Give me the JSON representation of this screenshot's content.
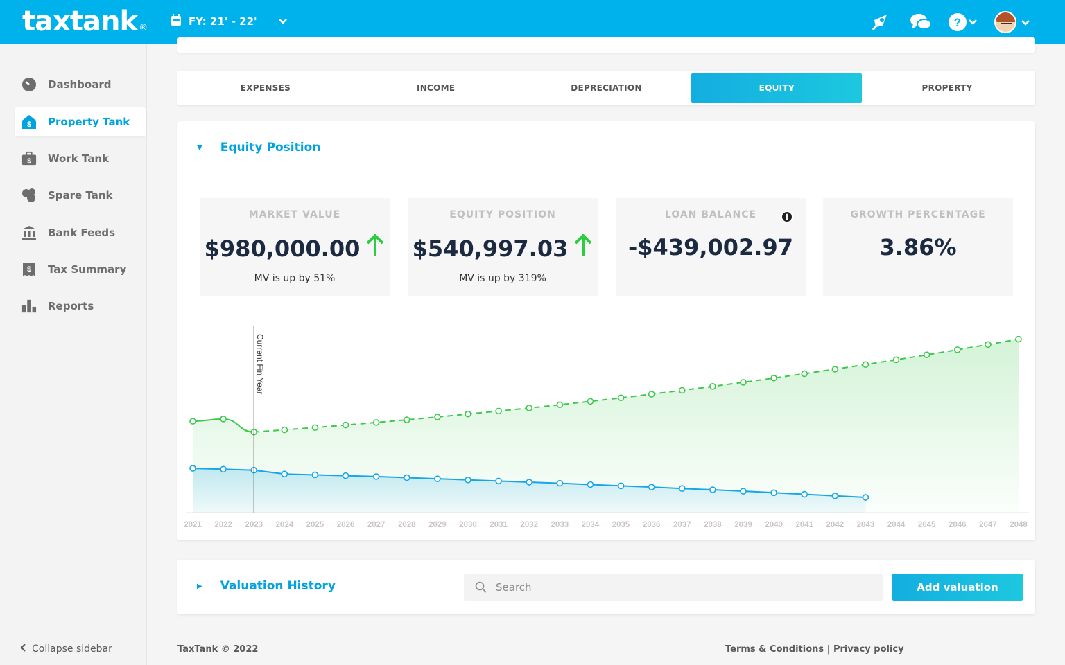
{
  "header": {
    "logo": "taxtank",
    "logo_mark": "®",
    "fy_label": "FY: 21' - 22'",
    "icons": [
      "rocket-icon",
      "chat-icon",
      "help-icon",
      "avatar"
    ]
  },
  "sidebar": {
    "items": [
      {
        "label": "Dashboard",
        "icon": "dashboard-icon",
        "active": false
      },
      {
        "label": "Property Tank",
        "icon": "property-icon",
        "active": true
      },
      {
        "label": "Work Tank",
        "icon": "briefcase-icon",
        "active": false
      },
      {
        "label": "Spare Tank",
        "icon": "coins-icon",
        "active": false
      },
      {
        "label": "Bank Feeds",
        "icon": "bank-icon",
        "active": false
      },
      {
        "label": "Tax Summary",
        "icon": "receipt-icon",
        "active": false
      },
      {
        "label": "Reports",
        "icon": "bar-chart-icon",
        "active": false
      }
    ],
    "collapse_label": "Collapse sidebar"
  },
  "tabs": [
    "EXPENSES",
    "INCOME",
    "DEPRECIATION",
    "EQUITY",
    "PROPERTY"
  ],
  "active_tab": "EQUITY",
  "equity": {
    "title": "Equity Position",
    "stats": [
      {
        "label": "MARKET VALUE",
        "value": "$980,000.00",
        "sub": "MV is up by 51%",
        "arrow": true
      },
      {
        "label": "EQUITY POSITION",
        "value": "$540,997.03",
        "sub": "MV is up by 319%",
        "arrow": true
      },
      {
        "label": "LOAN BALANCE",
        "value": "-$439,002.97",
        "sub": "",
        "info": true
      },
      {
        "label": "GROWTH PERCENTAGE",
        "value": "3.86%",
        "sub": ""
      }
    ],
    "current_year_label": "Current Fin Year"
  },
  "chart_data": {
    "type": "line",
    "x": [
      2021,
      2022,
      2023,
      2024,
      2025,
      2026,
      2027,
      2028,
      2029,
      2030,
      2031,
      2032,
      2033,
      2034,
      2035,
      2036,
      2037,
      2038,
      2039,
      2040,
      2041,
      2042,
      2043,
      2044,
      2045,
      2046,
      2047,
      2048
    ],
    "current_year": 2023,
    "series": [
      {
        "name": "",
        "color": "#3cc94b",
        "values": [
          648,
          664,
          571,
          587,
          603,
          621,
          639,
          658,
          678,
          699,
          720,
          742,
          765,
          789,
          814,
          840,
          867,
          895,
          924,
          954,
          985,
          1017,
          1050,
          1084,
          1119,
          1155,
          1192,
          1230
        ],
        "projected_from_index": 2
      },
      {
        "name": "",
        "color": "#14a6e6",
        "values": [
          314,
          308,
          301,
          274,
          268,
          262,
          256,
          248,
          240,
          232,
          224,
          216,
          208,
          199,
          190,
          181,
          171,
          162,
          152,
          141,
          130,
          119,
          108
        ]
      }
    ],
    "ylim": [
      0,
      1400
    ],
    "xlabel": "",
    "ylabel": "",
    "grid": false
  },
  "valuation": {
    "title": "Valuation History",
    "search_placeholder": "Search",
    "add_label": "Add valuation"
  },
  "footer": {
    "copyright": "TaxTank © 2022",
    "terms": "Terms & Conditions",
    "separator": " | ",
    "privacy": "Privacy policy"
  }
}
